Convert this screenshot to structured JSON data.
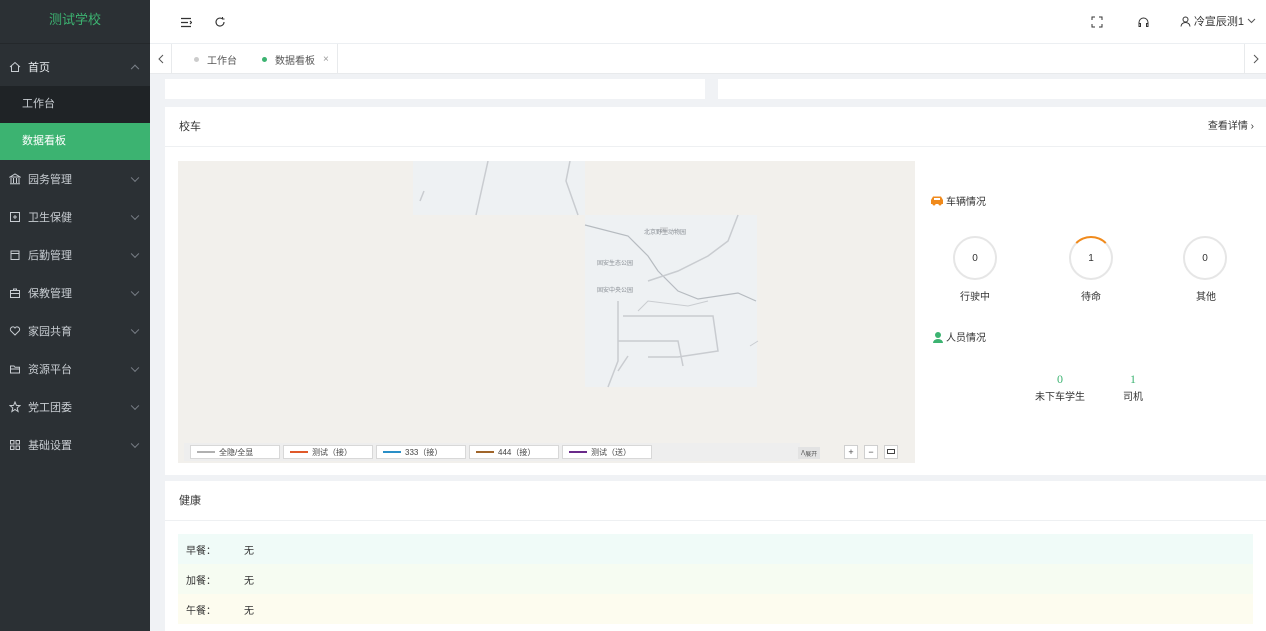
{
  "sidebar": {
    "brand": "测试学校",
    "items": [
      {
        "label": "首页",
        "icon": "home-icon",
        "open": true
      },
      {
        "label": "园务管理",
        "icon": "bank-icon"
      },
      {
        "label": "卫生保健",
        "icon": "medical-icon"
      },
      {
        "label": "后勤管理",
        "icon": "calendar-icon"
      },
      {
        "label": "保教管理",
        "icon": "briefcase-icon"
      },
      {
        "label": "家园共育",
        "icon": "heart-icon"
      },
      {
        "label": "资源平台",
        "icon": "folder-icon"
      },
      {
        "label": "党工团委",
        "icon": "star-icon"
      },
      {
        "label": "基础设置",
        "icon": "grid-icon"
      }
    ],
    "sub_items": [
      {
        "label": "工作台",
        "active": false
      },
      {
        "label": "数据看板",
        "active": true
      }
    ]
  },
  "header": {
    "user_name": "冷宣辰测1"
  },
  "tabs": {
    "items": [
      {
        "label": "工作台",
        "active": false
      },
      {
        "label": "数据看板",
        "active": true
      }
    ],
    "close_glyph": "×"
  },
  "bus_card": {
    "title": "校车",
    "detail_link": "查看详情",
    "map": {
      "labels": [
        "北京野生动物园",
        "固安生态公园",
        "固安中央公园"
      ],
      "legend": [
        {
          "label": "全隐/全显",
          "color": "#b0b0b0"
        },
        {
          "label": "测试（接）",
          "color": "#e0592a"
        },
        {
          "label": "333（接）",
          "color": "#2a8fc7"
        },
        {
          "label": "444（接）",
          "color": "#a0652a"
        },
        {
          "label": "测试（送）",
          "color": "#6a2a8a"
        }
      ],
      "expand_label": "展开",
      "zoom_in": "+",
      "zoom_out": "−"
    },
    "vehicle": {
      "title": "车辆情况",
      "stats": [
        {
          "value": "0",
          "label": "行驶中"
        },
        {
          "value": "1",
          "label": "待命"
        },
        {
          "value": "0",
          "label": "其他"
        }
      ]
    },
    "people": {
      "title": "人员情况",
      "stats": [
        {
          "value": "0",
          "label": "未下车学生"
        },
        {
          "value": "1",
          "label": "司机"
        }
      ]
    }
  },
  "health_card": {
    "title": "健康",
    "meals": [
      {
        "label": "早餐：",
        "value": "无"
      },
      {
        "label": "加餐：",
        "value": "无"
      },
      {
        "label": "午餐：",
        "value": "无"
      }
    ]
  },
  "colors": {
    "accent": "#3cb371",
    "sidebar_bg": "#2b3034",
    "bus_icon": "#f08a1c",
    "person_icon": "#3cb371"
  }
}
